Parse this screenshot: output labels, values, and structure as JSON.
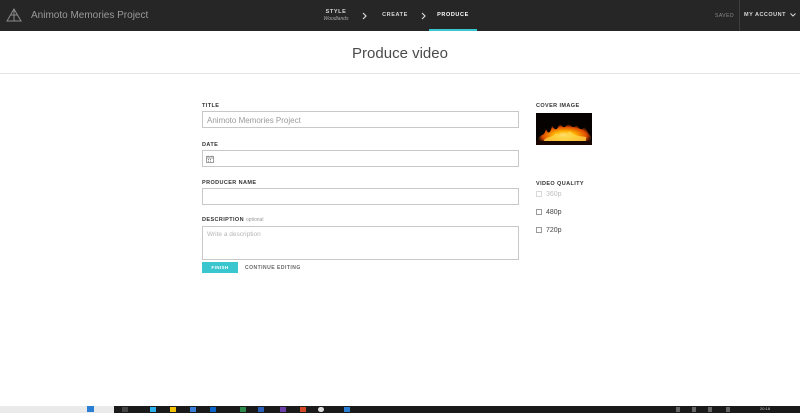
{
  "header": {
    "project_title": "Animoto Memories Project",
    "steps": [
      {
        "label": "STYLE",
        "sub": "Woodlands"
      },
      {
        "label": "CREATE"
      },
      {
        "label": "PRODUCE"
      }
    ],
    "saved_label": "SAVED",
    "account_label": "MY ACCOUNT"
  },
  "main": {
    "page_title": "Produce video",
    "form": {
      "title_label": "TITLE",
      "title_value": "Animoto Memories Project",
      "date_label": "DATE",
      "producer_label": "PRODUCER NAME",
      "description_label": "DESCRIPTION",
      "description_optional": "optional",
      "description_placeholder": "Write a description",
      "finish_label": "FINISH",
      "continue_label": "CONTINUE EDITING"
    },
    "sidebar": {
      "cover_label": "COVER IMAGE",
      "quality_label": "VIDEO QUALITY",
      "qualities": [
        {
          "label": "360p",
          "disabled": true
        },
        {
          "label": "480p",
          "disabled": false
        },
        {
          "label": "720p",
          "disabled": false
        }
      ]
    }
  },
  "taskbar": {
    "clock": "20:18"
  },
  "colors": {
    "accent": "#3ac6cf",
    "topbar": "#262626"
  }
}
